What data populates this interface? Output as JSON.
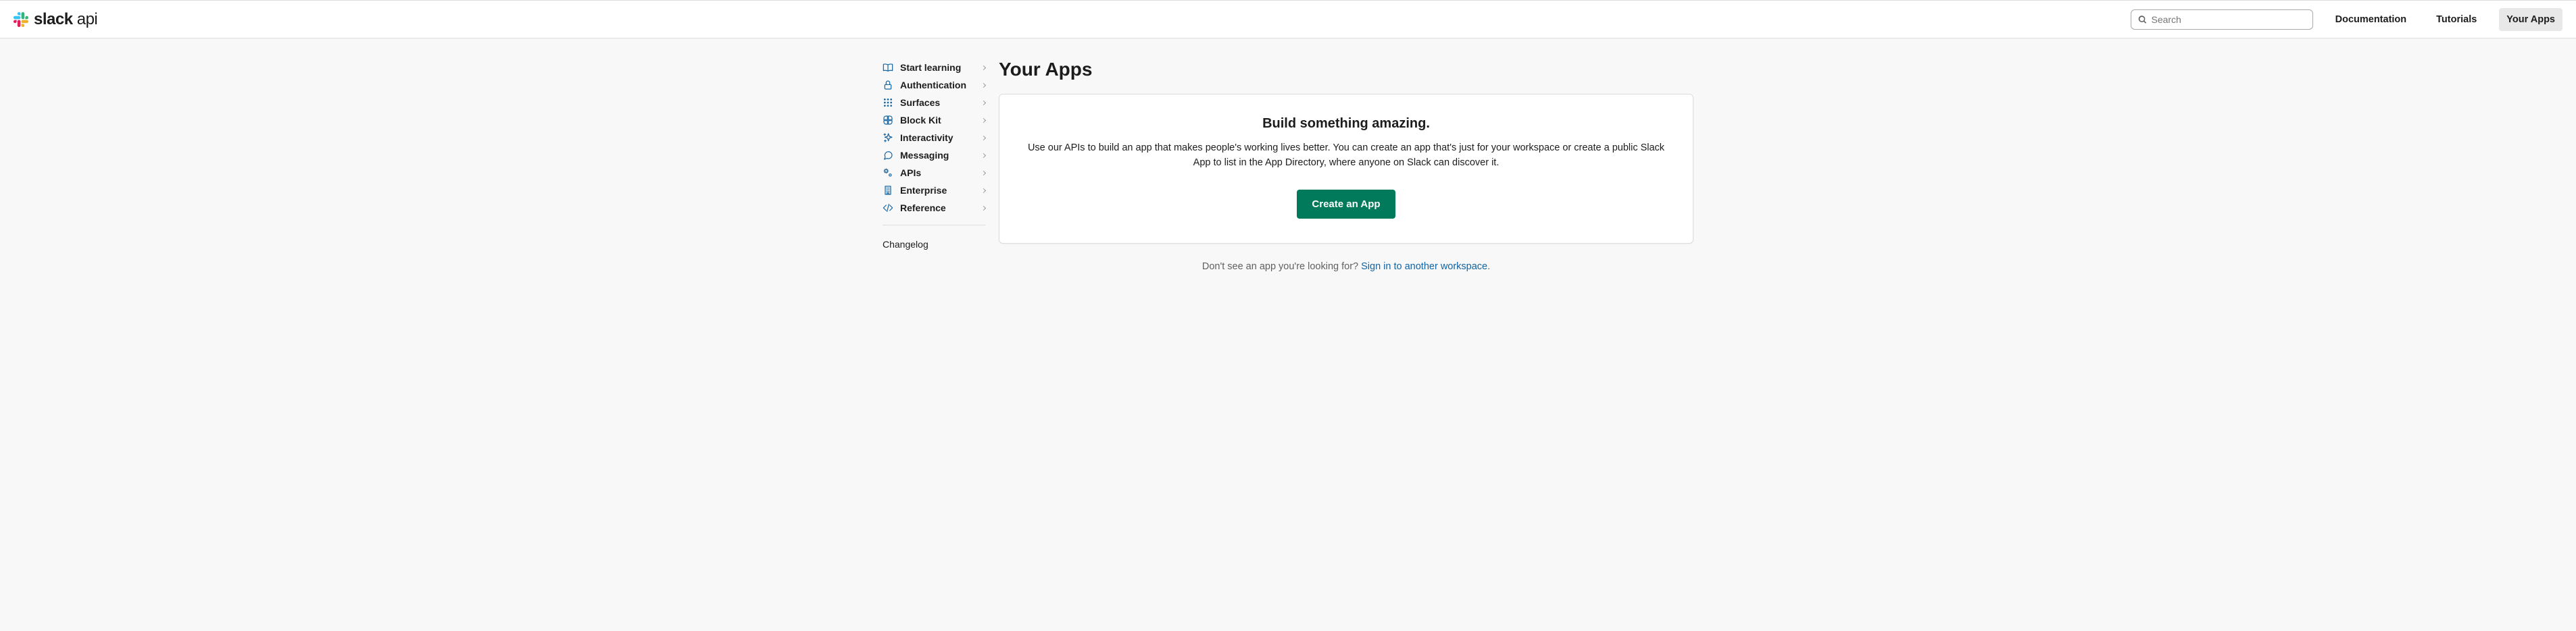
{
  "header": {
    "logo_bold": "slack",
    "logo_light": " api",
    "search_placeholder": "Search",
    "nav": {
      "documentation": "Documentation",
      "tutorials": "Tutorials",
      "your_apps": "Your Apps"
    }
  },
  "sidebar": {
    "items": [
      {
        "label": "Start learning",
        "name": "start-learning"
      },
      {
        "label": "Authentication",
        "name": "authentication"
      },
      {
        "label": "Surfaces",
        "name": "surfaces"
      },
      {
        "label": "Block Kit",
        "name": "block-kit"
      },
      {
        "label": "Interactivity",
        "name": "interactivity"
      },
      {
        "label": "Messaging",
        "name": "messaging"
      },
      {
        "label": "APIs",
        "name": "apis"
      },
      {
        "label": "Enterprise",
        "name": "enterprise"
      },
      {
        "label": "Reference",
        "name": "reference"
      }
    ],
    "changelog": "Changelog"
  },
  "main": {
    "title": "Your Apps",
    "card": {
      "heading": "Build something amazing.",
      "description": "Use our APIs to build an app that makes people's working lives better. You can create an app that's just for your workspace or create a public Slack App to list in the App Directory, where anyone on Slack can discover it.",
      "button": "Create an App"
    },
    "below": {
      "text": "Don't see an app you're looking for? ",
      "link": "Sign in to another workspace"
    }
  }
}
